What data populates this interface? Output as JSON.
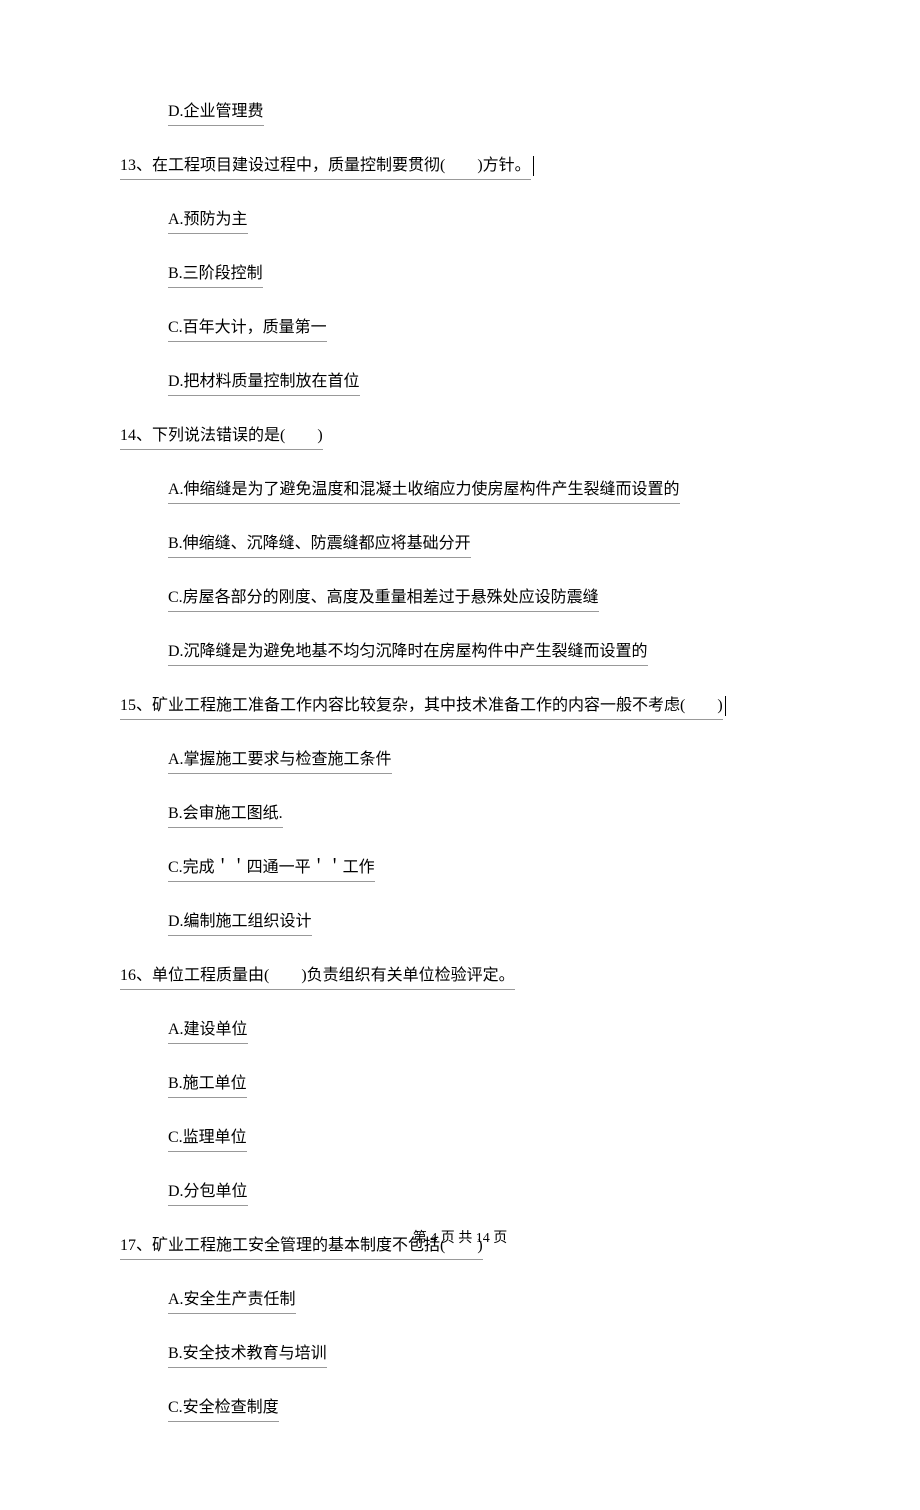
{
  "q12": {
    "optD": "D.企业管理费"
  },
  "q13": {
    "stem": "13、在工程项目建设过程中，质量控制要贯彻(　　)方针。",
    "optA": "A.预防为主",
    "optB": "B.三阶段控制",
    "optC": "C.百年大计，质量第一",
    "optD": "D.把材料质量控制放在首位"
  },
  "q14": {
    "stem": "14、下列说法错误的是(　　)",
    "optA": "A.伸缩缝是为了避免温度和混凝土收缩应力使房屋构件产生裂缝而设置的",
    "optB": "B.伸缩缝、沉降缝、防震缝都应将基础分开",
    "optC": "C.房屋各部分的刚度、高度及重量相差过于悬殊处应设防震缝",
    "optD": "D.沉降缝是为避免地基不均匀沉降时在房屋构件中产生裂缝而设置的"
  },
  "q15": {
    "stem": "15、矿业工程施工准备工作内容比较复杂，其中技术准备工作的内容一般不考虑(　　)",
    "optA": "A.掌握施工要求与检查施工条件",
    "optB": "B.会审施工图纸.",
    "optC": "C.完成＇＇四通一平＇＇工作",
    "optD": "D.编制施工组织设计"
  },
  "q16": {
    "stem": "16、单位工程质量由(　　)负责组织有关单位检验评定。",
    "optA": "A.建设单位",
    "optB": "B.施工单位",
    "optC": "C.监理单位",
    "optD": "D.分包单位"
  },
  "q17": {
    "stem": "17、矿业工程施工安全管理的基本制度不包括(　　)",
    "optA": "A.安全生产责任制",
    "optB": "B.安全技术教育与培训",
    "optC": "C.安全检查制度"
  },
  "footer": "第 4 页 共 14 页"
}
